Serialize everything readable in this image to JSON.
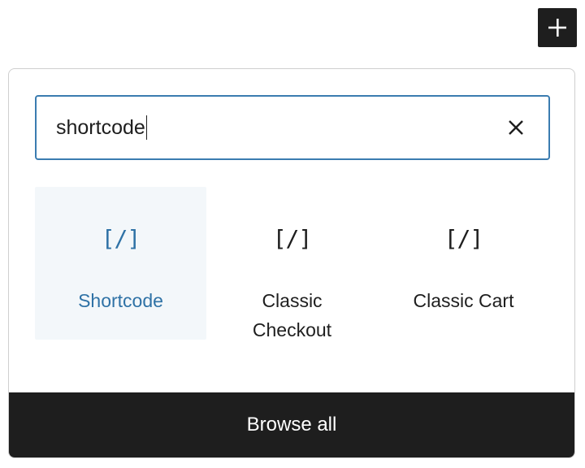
{
  "toolbar": {
    "add_button_icon": "plus-icon"
  },
  "search": {
    "value": "shortcode",
    "clear_icon": "close-icon"
  },
  "results": [
    {
      "label": "Shortcode",
      "icon": "[/]",
      "icon_name": "shortcode-icon",
      "selected": true
    },
    {
      "label": "Classic Checkout",
      "icon": "[/]",
      "icon_name": "shortcode-icon",
      "selected": false
    },
    {
      "label": "Classic Cart",
      "icon": "[/]",
      "icon_name": "shortcode-icon",
      "selected": false
    }
  ],
  "footer": {
    "browse_all_label": "Browse all"
  },
  "colors": {
    "accent": "#3b7cb0",
    "selected_text": "#2f72a6",
    "selected_bg": "#f3f7fa",
    "dark": "#1e1e1e"
  }
}
